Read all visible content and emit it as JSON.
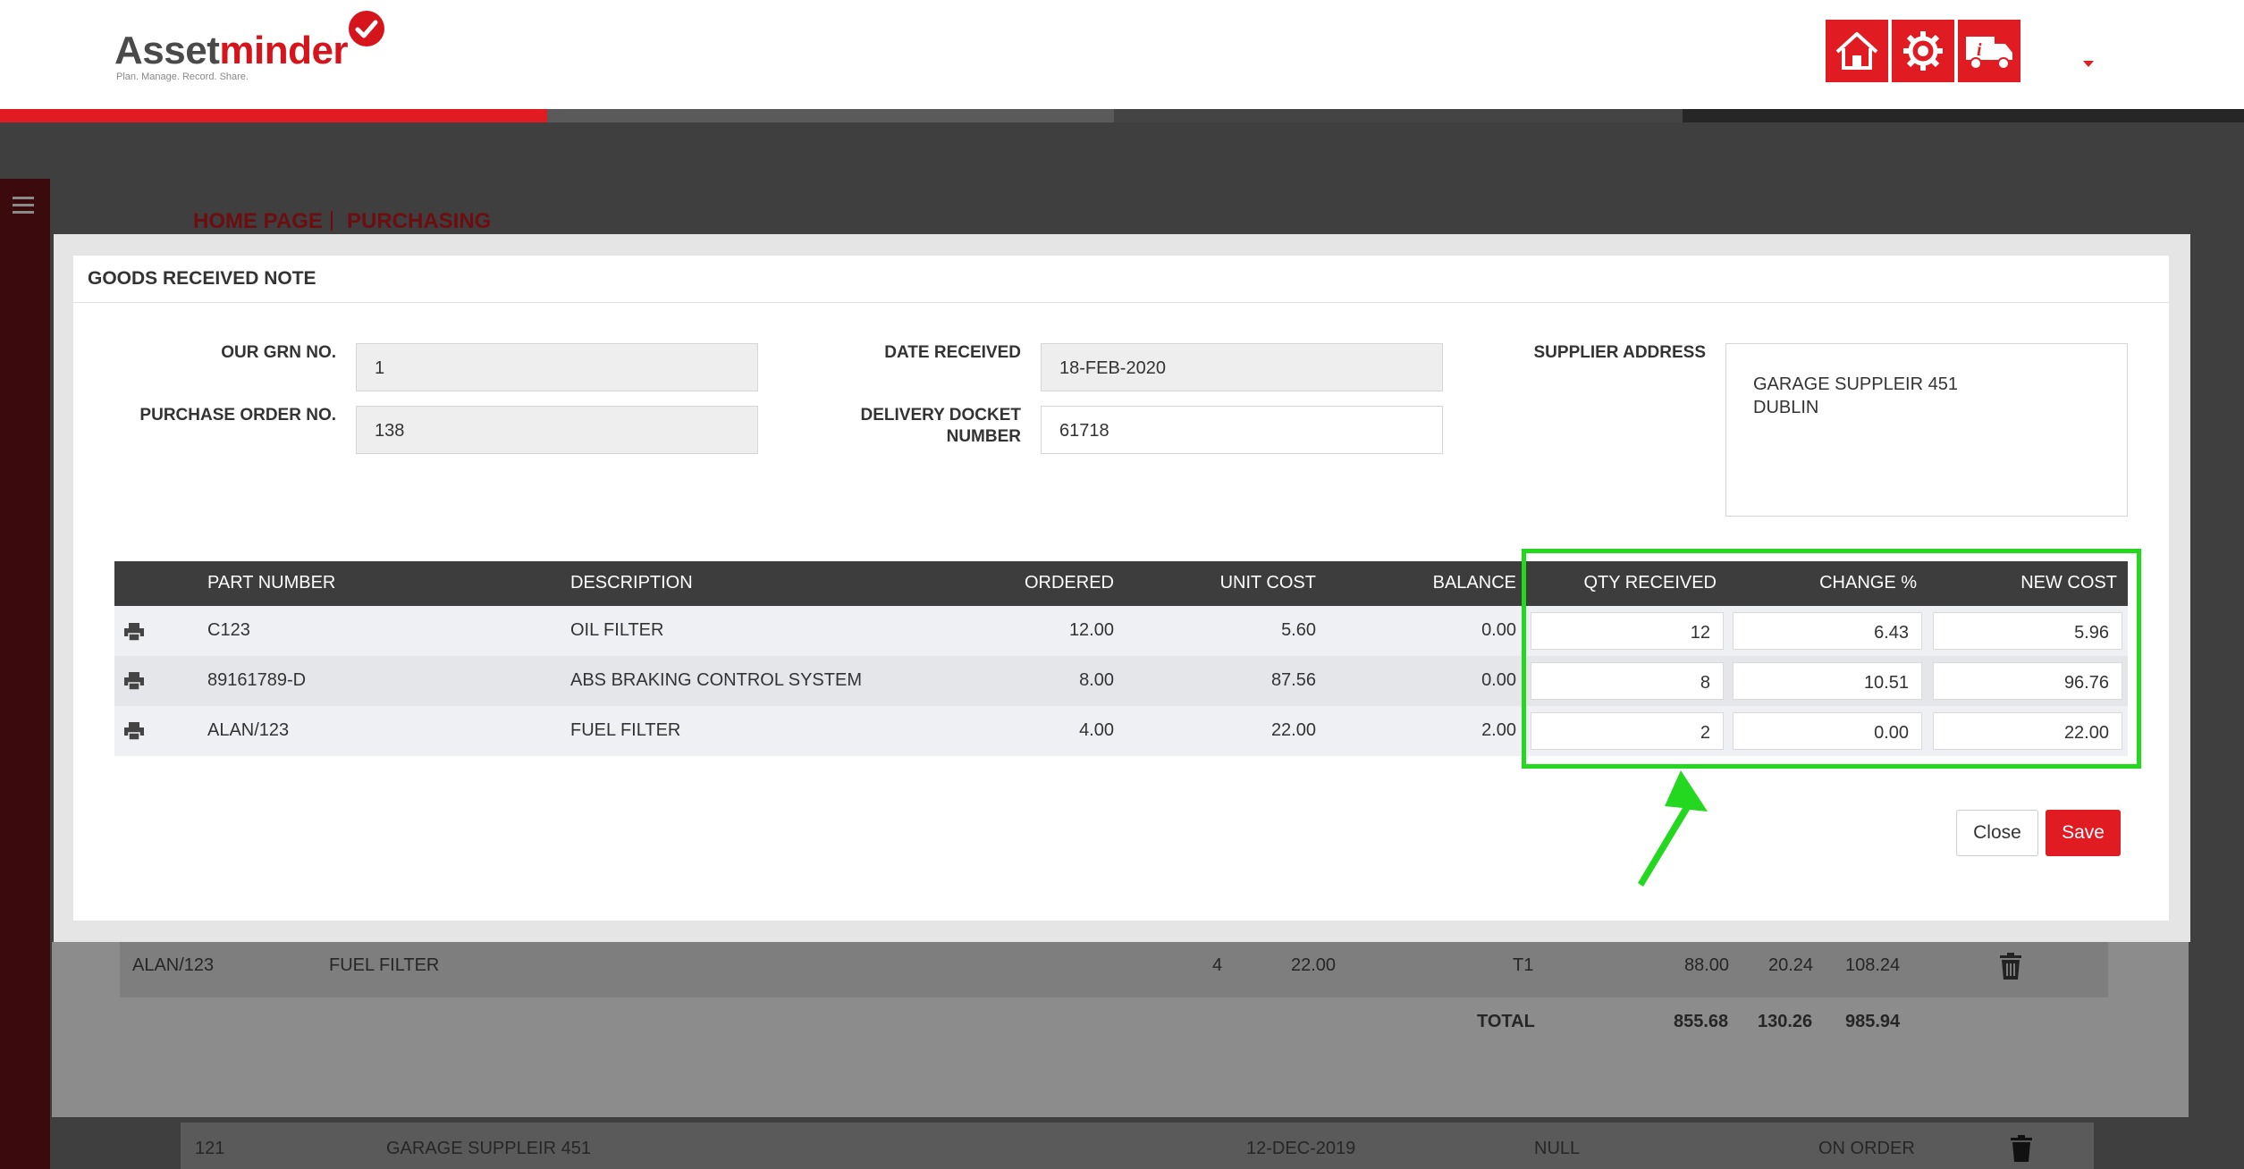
{
  "brand": {
    "name_part1": "Asset",
    "name_part2": "minder",
    "tagline": "Plan. Manage. Record. Share.",
    "accent_color": "#e01b22"
  },
  "header": {
    "buttons": [
      {
        "icon": "home-icon"
      },
      {
        "icon": "gear-icon"
      },
      {
        "icon": "truck-info-icon"
      }
    ]
  },
  "breadcrumb": {
    "home": "HOME PAGE",
    "section": "PURCHASING"
  },
  "modal": {
    "title": "GOODS RECEIVED NOTE",
    "fields": {
      "grn_label": "OUR GRN NO.",
      "grn_value": "1",
      "po_label": "PURCHASE ORDER NO.",
      "po_value": "138",
      "date_label": "DATE RECEIVED",
      "date_value": "18-FEB-2020",
      "docket_label_1": "DELIVERY DOCKET",
      "docket_label_2": "NUMBER",
      "docket_value": "61718",
      "supplier_label": "SUPPLIER ADDRESS",
      "supplier_line1": "GARAGE SUPPLEIR 451",
      "supplier_line2": "DUBLIN"
    },
    "table": {
      "headers": {
        "part": "PART NUMBER",
        "description": "DESCRIPTION",
        "ordered": "ORDERED",
        "unit_cost": "UNIT COST",
        "balance": "BALANCE",
        "qty_received": "QTY RECEIVED",
        "change": "CHANGE %",
        "new_cost": "NEW COST"
      },
      "rows": [
        {
          "part": "C123",
          "description": "OIL FILTER",
          "ordered": "12.00",
          "unit_cost": "5.60",
          "balance": "0.00",
          "qty_received": "12",
          "change": "6.43",
          "new_cost": "5.96"
        },
        {
          "part": "89161789-D",
          "description": "ABS BRAKING CONTROL SYSTEM",
          "ordered": "8.00",
          "unit_cost": "87.56",
          "balance": "0.00",
          "qty_received": "8",
          "change": "10.51",
          "new_cost": "96.76"
        },
        {
          "part": "ALAN/123",
          "description": "FUEL FILTER",
          "ordered": "4.00",
          "unit_cost": "22.00",
          "balance": "2.00",
          "qty_received": "2",
          "change": "0.00",
          "new_cost": "22.00"
        }
      ]
    },
    "buttons": {
      "close": "Close",
      "save": "Save"
    },
    "highlight_color": "#23d81f"
  },
  "background_page": {
    "line": {
      "part": "ALAN/123",
      "description": "FUEL FILTER",
      "qty": "4",
      "price": "22.00",
      "tax_code": "T1",
      "net": "88.00",
      "vat": "20.24",
      "gross": "108.24"
    },
    "totals": {
      "label": "TOTAL",
      "net": "855.68",
      "vat": "130.26",
      "gross": "985.94"
    },
    "order_row": {
      "id": "121",
      "supplier": "GARAGE SUPPLEIR 451",
      "date": "12-DEC-2019",
      "value": "NULL",
      "status": "ON ORDER"
    }
  }
}
